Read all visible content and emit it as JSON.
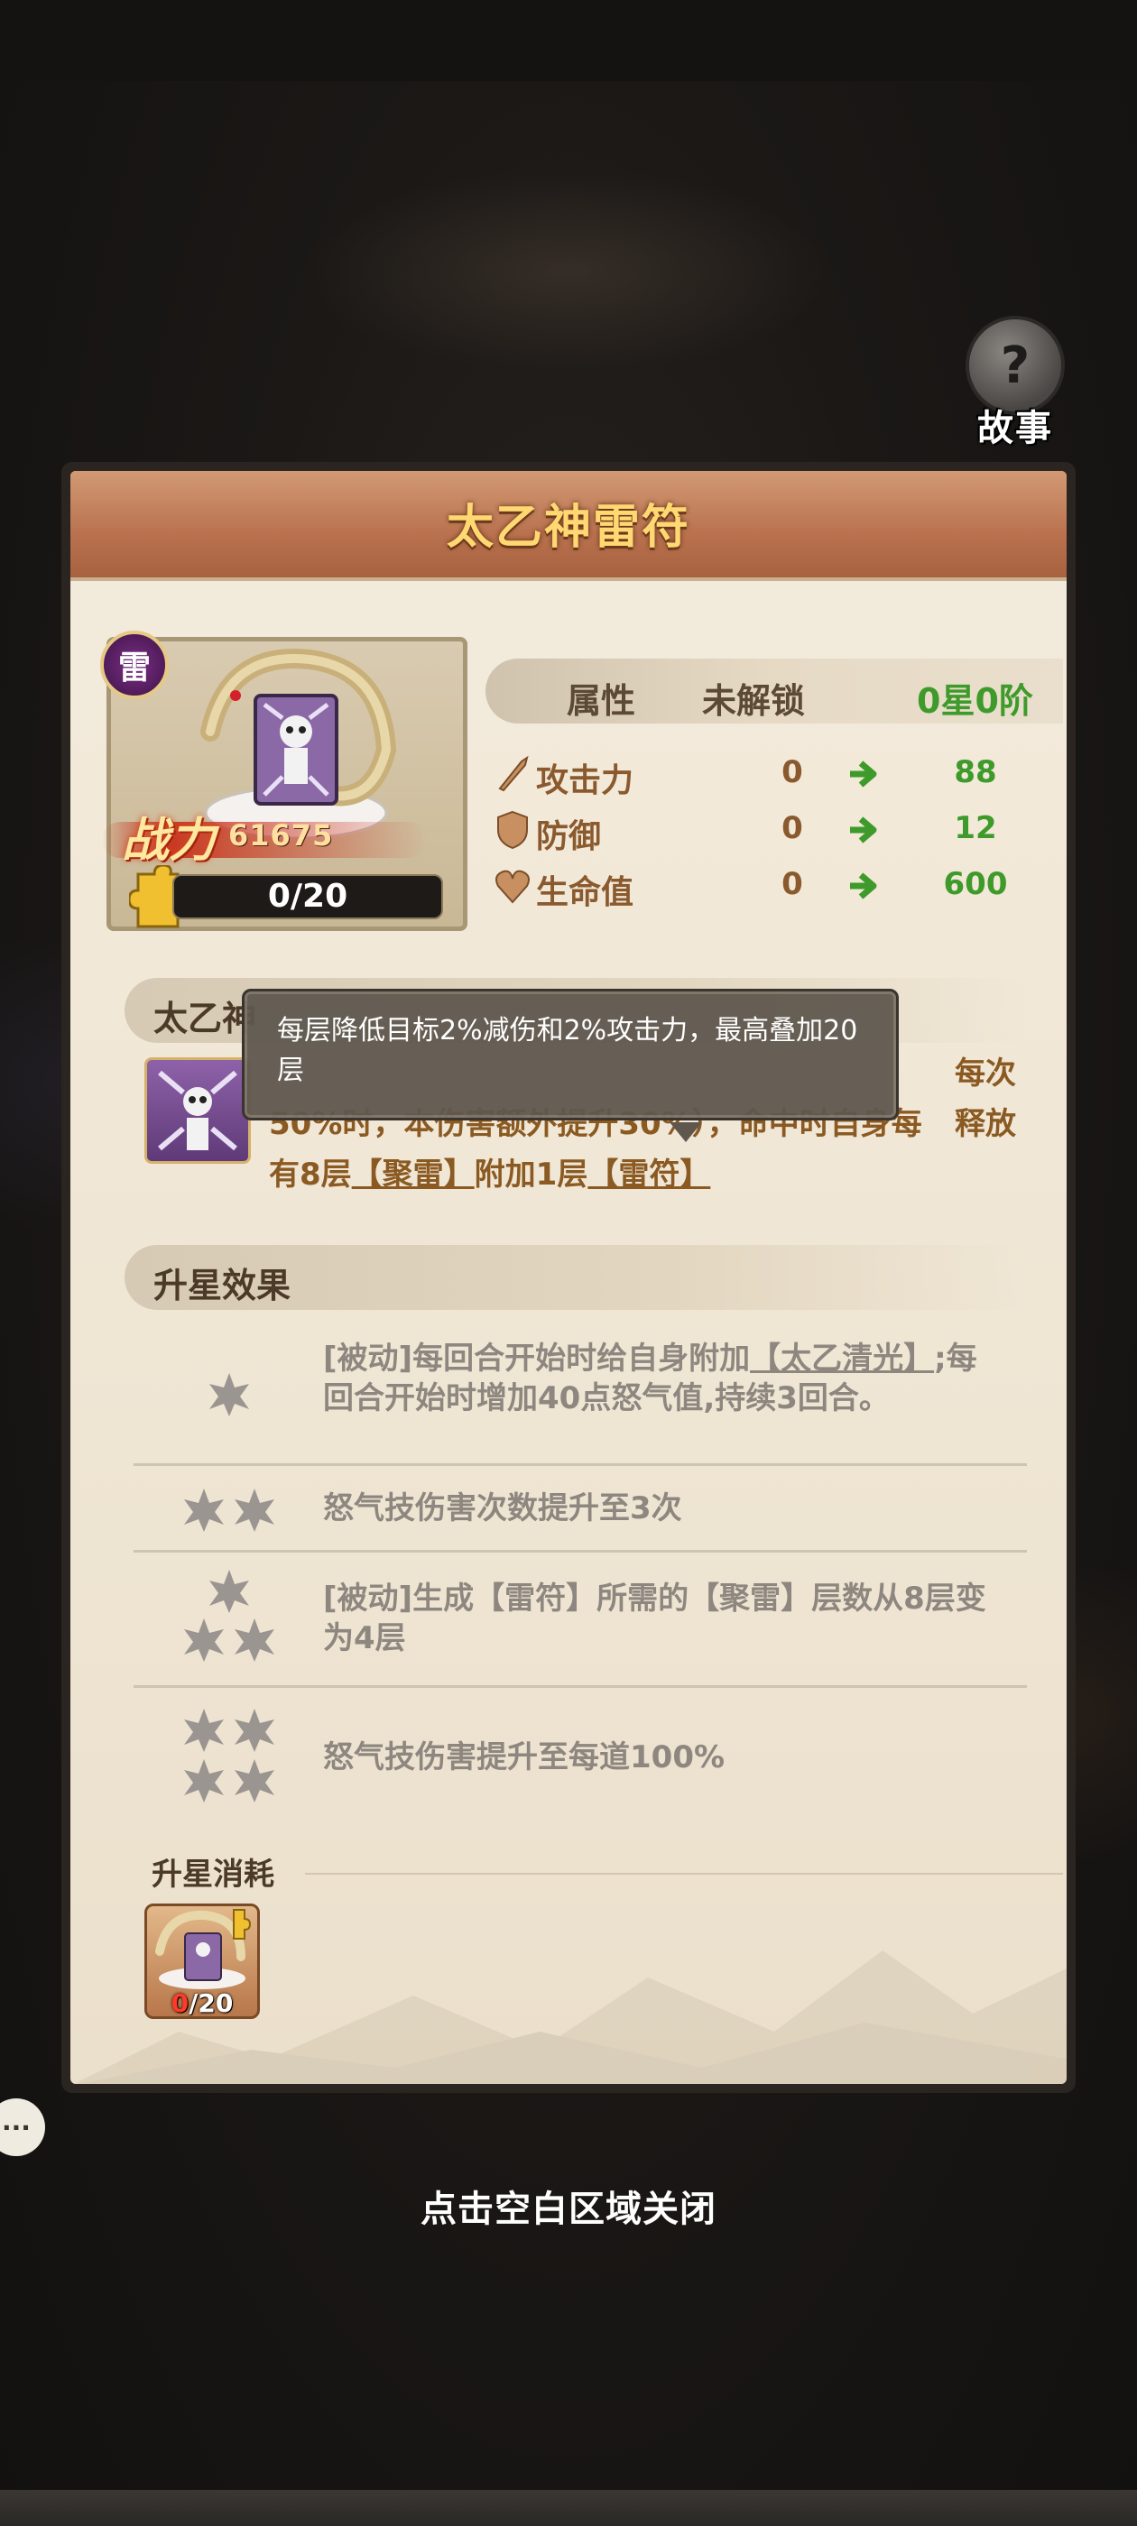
{
  "story_button": {
    "label": "故事",
    "icon": "question-book-icon"
  },
  "card": {
    "title": "太乙神雷符",
    "element_badge": "雷",
    "power_label": "战力",
    "power_value": "61675",
    "shard_progress": "0/20"
  },
  "attributes": {
    "headers": {
      "attr": "属性",
      "locked": "未解锁",
      "star": "0星0阶"
    },
    "rows": [
      {
        "name": "攻击力",
        "current": "0",
        "next": "88",
        "icon": "sword-icon"
      },
      {
        "name": "防御",
        "current": "0",
        "next": "12",
        "icon": "shield-icon"
      },
      {
        "name": "生命值",
        "current": "0",
        "next": "600",
        "icon": "heart-icon"
      }
    ]
  },
  "skill": {
    "title": "太乙神",
    "right_fragment": "每次释放",
    "line2": "50%时，本伤害额外提升30%），命中时自身每",
    "line3_a": "有8层",
    "line3_link1": "【聚雷】",
    "line3_b": "附加1层",
    "line3_link2": "【雷符】"
  },
  "tooltip": {
    "text": "每层降低目标2%减伤和2%攻击力，最高叠加20层"
  },
  "star_effects": {
    "title": "升星效果",
    "items": [
      {
        "desc_a": "[被动]每回合开始时给自身附加",
        "link": "【太乙清光】",
        "desc_b": ";每回合开始时增加40点怒气值,持续3回合。"
      },
      {
        "desc": "怒气技伤害次数提升至3次"
      },
      {
        "desc": "[被动]生成【雷符】所需的【聚雷】层数从8层变为4层"
      },
      {
        "desc": "怒气技伤害提升至每道100%"
      }
    ]
  },
  "cost": {
    "title": "升星消耗",
    "have": "0",
    "need": "/20"
  },
  "close_hint": "点击空白区域关闭",
  "colors": {
    "green": "#3e9a2a",
    "brown": "#8a5a2e",
    "gold": "#ffd872"
  }
}
